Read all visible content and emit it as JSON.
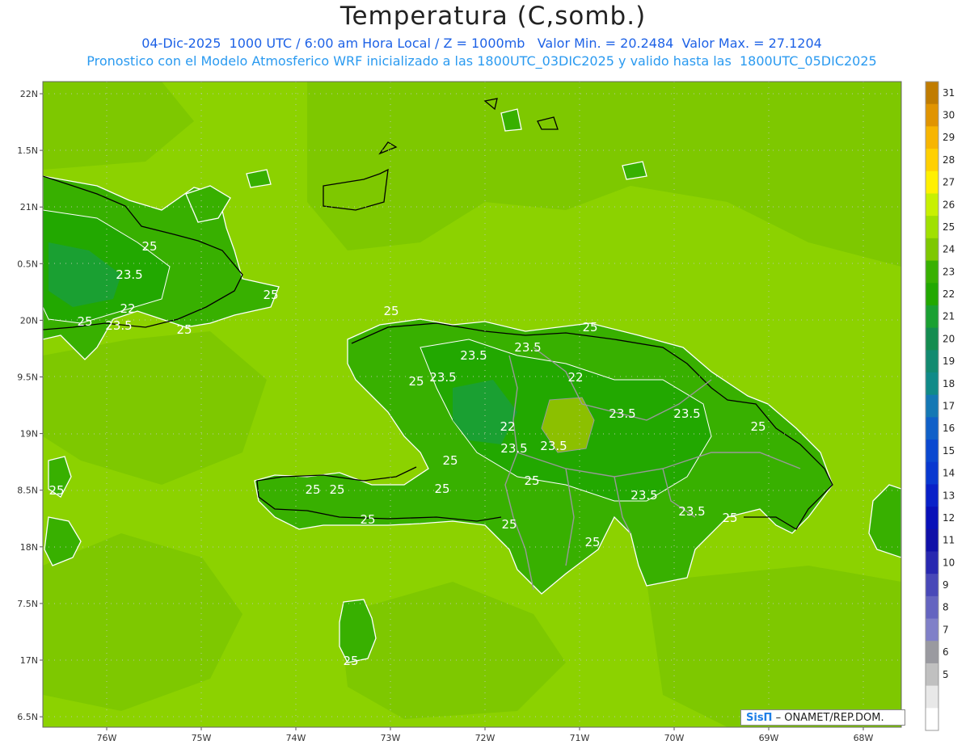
{
  "title": "Temperatura (C,somb.)",
  "subtitle_line1": "04-Dic-2025  1000 UTC / 6:00 am Hora Local / Z = 1000mb   Valor Min. = 20.2484  Valor Max. = 27.1204",
  "subtitle_line2": "Pronostico con el Modelo Atmosferico WRF inicializado a las 1800UTC_03DIC2025 y valido hasta las  1800UTC_05DIC2025",
  "credit": {
    "brand": "SisΠ",
    "text": "– ONAMET/REP.DOM."
  },
  "axes": {
    "lat_labels": [
      "22N",
      "1.5N",
      "21N",
      "0.5N",
      "20N",
      "9.5N",
      "19N",
      "8.5N",
      "18N",
      "7.5N",
      "17N",
      "6.5N"
    ],
    "lon_labels": [
      "76W",
      "75W",
      "74W",
      "73W",
      "72W",
      "71W",
      "70W",
      "69W",
      "68W"
    ]
  },
  "colorbar": {
    "labels": [
      "31",
      "30",
      "29",
      "28",
      "27",
      "26",
      "25",
      "24",
      "23",
      "22",
      "21",
      "20",
      "19",
      "18",
      "17",
      "16",
      "15",
      "14",
      "13",
      "12",
      "11",
      "10",
      "9",
      "8",
      "7",
      "6",
      "5"
    ],
    "colors": [
      "#c07c00",
      "#e09400",
      "#f7b500",
      "#ffd000",
      "#fff000",
      "#c8f000",
      "#a0e000",
      "#7ec800",
      "#38b000",
      "#22a800",
      "#1aa032",
      "#148c50",
      "#128a70",
      "#108a88",
      "#1478b4",
      "#1060c8",
      "#0a48d0",
      "#0838d0",
      "#0820c8",
      "#0810b8",
      "#1010a8",
      "#2828b0",
      "#4848b8",
      "#6464c0",
      "#8080c8",
      "#9a9aa0",
      "#c0c0c0",
      "#e8e8e8",
      "#ffffff"
    ]
  },
  "contour_labels": [
    "25",
    "23.5",
    "22",
    "25",
    "23.5",
    "25",
    "25",
    "25",
    "23.5",
    "23.5",
    "25",
    "23.5",
    "22",
    "25",
    "23.5",
    "23.5",
    "22",
    "23.5",
    "23.5",
    "25",
    "25",
    "25",
    "25",
    "25",
    "25",
    "25",
    "25",
    "23.5",
    "23.5",
    "25",
    "25",
    "25",
    "25"
  ]
}
